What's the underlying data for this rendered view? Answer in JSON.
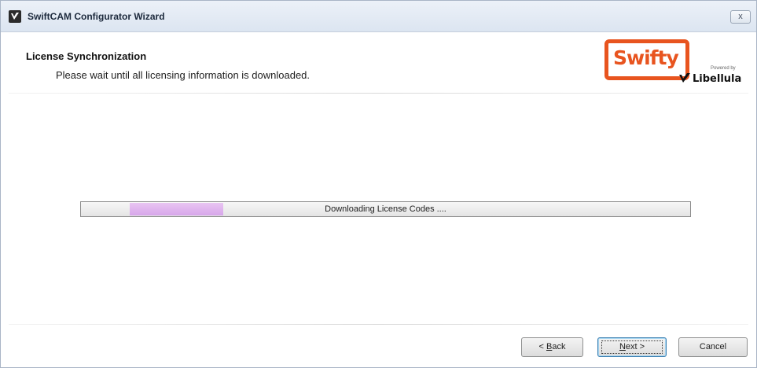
{
  "window": {
    "title": "SwiftCAM Configurator Wizard",
    "close_label": "x"
  },
  "header": {
    "title": "License Synchronization",
    "subtitle": "Please wait until all licensing information is downloaded."
  },
  "branding": {
    "logo_text": "Swifty",
    "powered_by": "Powered by",
    "partner": "Libellula",
    "logo_color": "#e8541f"
  },
  "progress": {
    "label": "Downloading License Codes ....",
    "fill_color": "#d7a6ea"
  },
  "buttons": {
    "back_prefix": "< ",
    "back_accel": "B",
    "back_rest": "ack",
    "next_accel": "N",
    "next_rest": "ext >",
    "cancel": "Cancel"
  }
}
